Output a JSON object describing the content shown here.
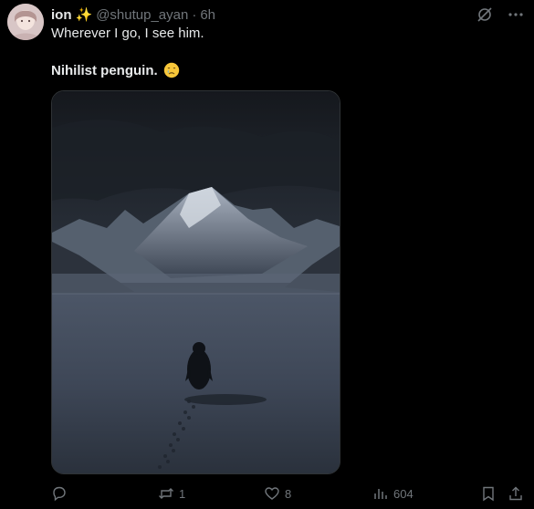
{
  "tweet": {
    "display_name": "ion",
    "name_badge": "✨",
    "handle": "@shutup_ayan",
    "separator": "·",
    "time": "6h",
    "text_line1": "Wherever I go, I see him.",
    "text_line2": "Nihilist penguin."
  },
  "actions": {
    "replies": "",
    "reposts": "1",
    "likes": "8",
    "views": "604"
  },
  "icons": {
    "avatar": "avatar-icon",
    "grok": "grok-icon",
    "more": "more-icon",
    "reply": "reply-icon",
    "repost": "repost-icon",
    "like": "heart-icon",
    "views": "views-icon",
    "bookmark": "bookmark-icon",
    "share": "share-icon"
  },
  "colors": {
    "background": "#000000",
    "text": "#e7e9ea",
    "muted": "#71767b",
    "sparkle": "#f6c642"
  }
}
